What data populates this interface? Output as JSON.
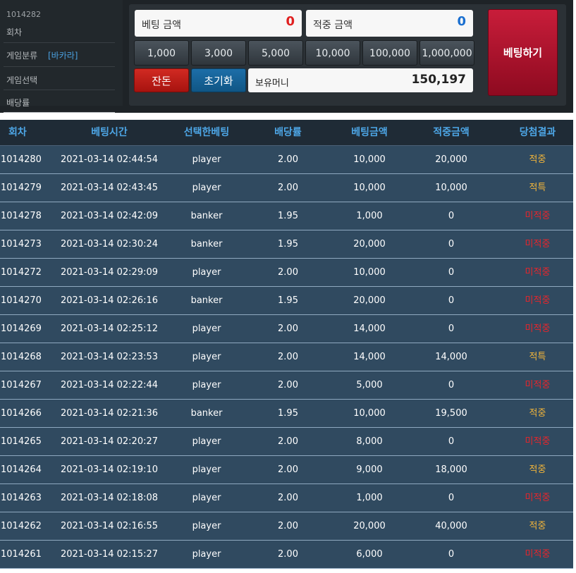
{
  "info": {
    "round_num": "1014282",
    "round_label": "회차",
    "game_type_label": "게임분류",
    "game_type_value": "[바카라]",
    "game_select_label": "게임선택",
    "odds_label": "배당률"
  },
  "bet_panel": {
    "bet_amount_label": "베팅 금액",
    "bet_amount_value": "0",
    "win_amount_label": "적중 금액",
    "win_amount_value": "0",
    "chips": [
      "1,000",
      "3,000",
      "5,000",
      "10,000",
      "100,000",
      "1,000,000"
    ],
    "change_label": "잔돈",
    "reset_label": "초기화",
    "balance_label": "보유머니",
    "balance_value": "150,197",
    "bet_button_label": "베팅하기",
    "colors": {
      "bet_value": "#e02020",
      "win_value": "#1a6fd0"
    }
  },
  "table": {
    "headers": [
      "회차",
      "베팅시간",
      "선택한베팅",
      "배당률",
      "베팅금액",
      "적중금액",
      "당첨결과"
    ],
    "rows": [
      [
        "1014280",
        "2021-03-14 02:44:54",
        "player",
        "2.00",
        "10,000",
        "20,000",
        "적중"
      ],
      [
        "1014279",
        "2021-03-14 02:43:45",
        "player",
        "2.00",
        "10,000",
        "10,000",
        "적특"
      ],
      [
        "1014278",
        "2021-03-14 02:42:09",
        "banker",
        "1.95",
        "1,000",
        "0",
        "미적중"
      ],
      [
        "1014273",
        "2021-03-14 02:30:24",
        "banker",
        "1.95",
        "20,000",
        "0",
        "미적중"
      ],
      [
        "1014272",
        "2021-03-14 02:29:09",
        "player",
        "2.00",
        "10,000",
        "0",
        "미적중"
      ],
      [
        "1014270",
        "2021-03-14 02:26:16",
        "banker",
        "1.95",
        "20,000",
        "0",
        "미적중"
      ],
      [
        "1014269",
        "2021-03-14 02:25:12",
        "player",
        "2.00",
        "14,000",
        "0",
        "미적중"
      ],
      [
        "1014268",
        "2021-03-14 02:23:53",
        "player",
        "2.00",
        "14,000",
        "14,000",
        "적특"
      ],
      [
        "1014267",
        "2021-03-14 02:22:44",
        "player",
        "2.00",
        "5,000",
        "0",
        "미적중"
      ],
      [
        "1014266",
        "2021-03-14 02:21:36",
        "banker",
        "1.95",
        "10,000",
        "19,500",
        "적중"
      ],
      [
        "1014265",
        "2021-03-14 02:20:27",
        "player",
        "2.00",
        "8,000",
        "0",
        "미적중"
      ],
      [
        "1014264",
        "2021-03-14 02:19:10",
        "player",
        "2.00",
        "9,000",
        "18,000",
        "적중"
      ],
      [
        "1014263",
        "2021-03-14 02:18:08",
        "player",
        "2.00",
        "1,000",
        "0",
        "미적중"
      ],
      [
        "1014262",
        "2021-03-14 02:16:55",
        "player",
        "2.00",
        "20,000",
        "40,000",
        "적중"
      ],
      [
        "1014261",
        "2021-03-14 02:15:27",
        "player",
        "2.00",
        "6,000",
        "0",
        "미적중"
      ]
    ],
    "colors": {
      "win": "#f2b53a",
      "lose": "#e8252b"
    }
  }
}
